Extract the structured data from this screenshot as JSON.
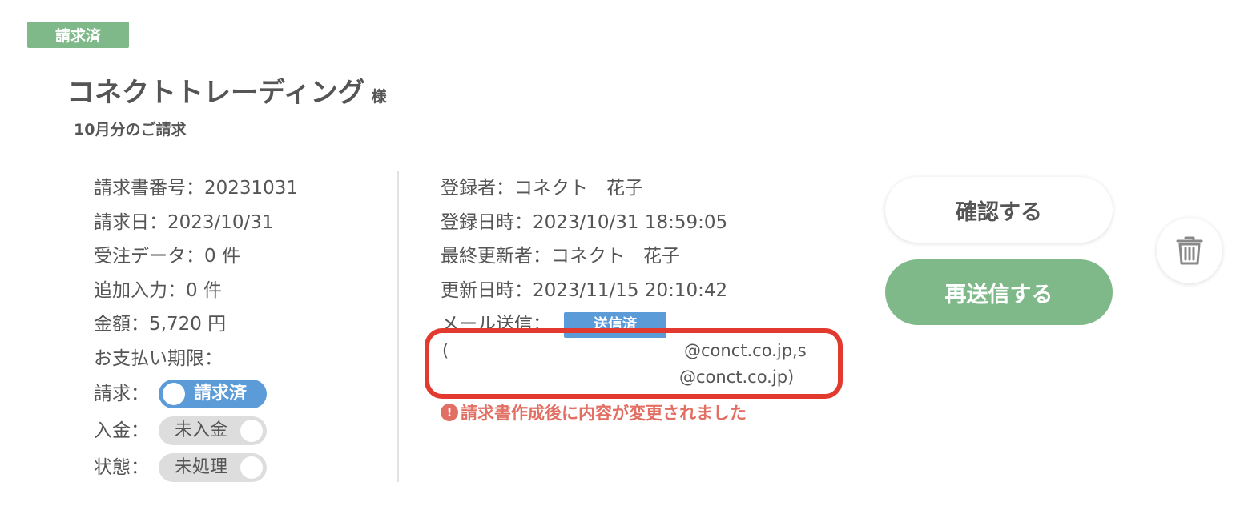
{
  "header": {
    "status": "請求済",
    "client_name": "コネクトトレーディング",
    "client_suffix": "様",
    "period": "10月分のご請求"
  },
  "details_left": {
    "invoice_number": "請求書番号：20231031",
    "invoice_date": "請求日：2023/10/31",
    "order_data": "受注データ：0 件",
    "additional_input": "追加入力：0 件",
    "amount": "金額：5,720 円",
    "due_date": "お支払い期限：",
    "billing_label": "請求：",
    "billing_toggle": "請求済",
    "payment_label": "入金：",
    "payment_toggle": "未入金",
    "state_label": "状態：",
    "state_toggle": "未処理"
  },
  "details_right": {
    "registrant": "登録者：コネクト　花子",
    "registered_at": "登録日時：2023/10/31 18:59:05",
    "last_updater": "最終更新者：コネクト　花子",
    "updated_at": "更新日時：2023/11/15 20:10:42",
    "mail_label": "メール送信：",
    "mail_status": "送信済",
    "email_open_paren": "(",
    "email_line1": "@conct.co.jp,s",
    "email_line2": "@conct.co.jp)",
    "warning": "請求書作成後に内容が変更されました"
  },
  "actions": {
    "confirm": "確認する",
    "resend": "再送信する"
  },
  "colors": {
    "accent_green": "#7fb98a",
    "accent_blue": "#5b9bd8",
    "warning_red": "#e26f63",
    "highlight_red": "#e23a2e"
  }
}
